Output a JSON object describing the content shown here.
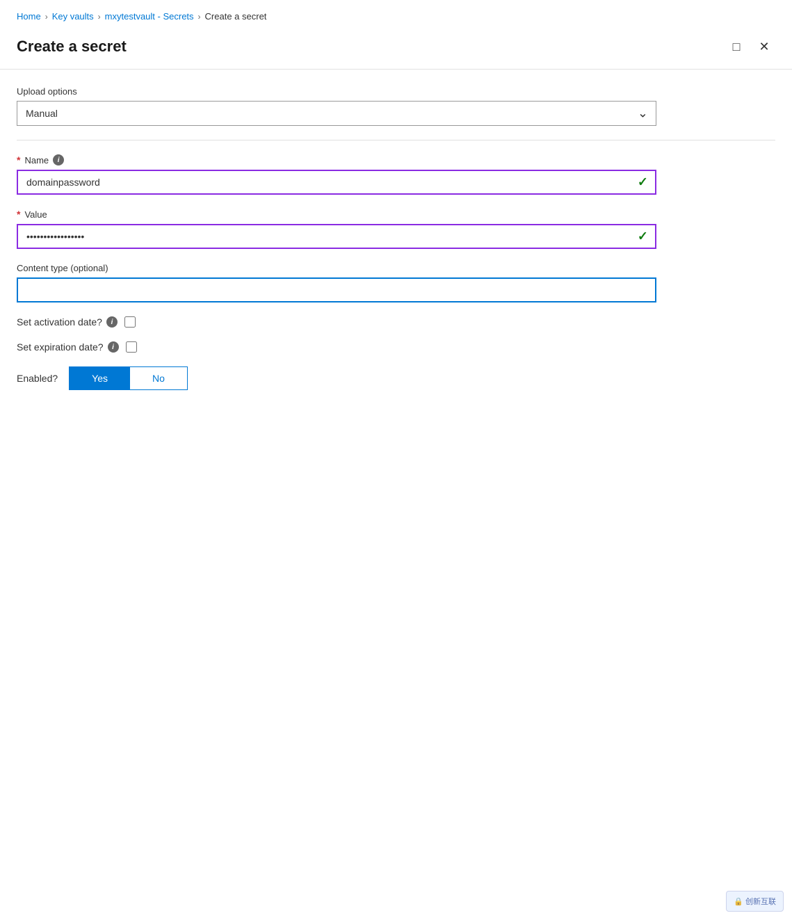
{
  "breadcrumb": {
    "items": [
      {
        "label": "Home",
        "link": true
      },
      {
        "label": "Key vaults",
        "link": true
      },
      {
        "label": "mxytestvault - Secrets",
        "link": true
      },
      {
        "label": "Create a secret",
        "link": false
      }
    ]
  },
  "panel": {
    "title": "Create a secret",
    "minimize_label": "□",
    "close_label": "✕"
  },
  "form": {
    "upload_options_label": "Upload options",
    "upload_options_value": "Manual",
    "upload_options_placeholder": "Manual",
    "name_label": "Name",
    "name_required": true,
    "name_value": "domainpassword",
    "name_valid": true,
    "value_label": "Value",
    "value_required": true,
    "value_placeholder": "••••••••••••••",
    "value_valid": true,
    "content_type_label": "Content type (optional)",
    "content_type_value": "",
    "content_type_placeholder": "",
    "activation_date_label": "Set activation date?",
    "activation_date_checked": false,
    "expiration_date_label": "Set expiration date?",
    "expiration_date_checked": false,
    "enabled_label": "Enabled?",
    "enabled_yes": "Yes",
    "enabled_no": "No",
    "enabled_value": "yes"
  },
  "watermark": {
    "text": "🔒 创新互联"
  },
  "icons": {
    "info": "i",
    "chevron_down": "⌄",
    "check": "✓"
  }
}
